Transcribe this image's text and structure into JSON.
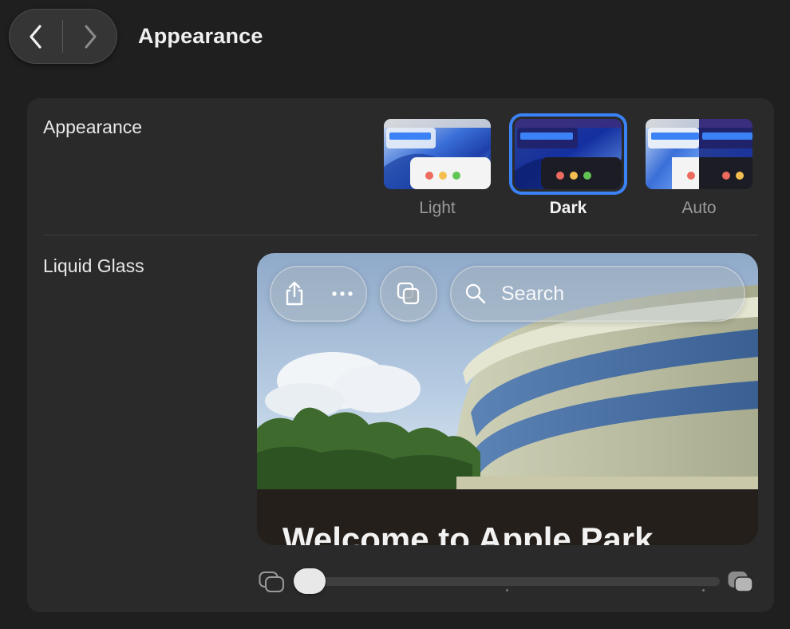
{
  "window": {
    "title": "Appearance",
    "back_icon": "chevron-left-icon",
    "forward_icon": "chevron-right-icon"
  },
  "appearance": {
    "label": "Appearance",
    "options": [
      {
        "label": "Light",
        "selected": false
      },
      {
        "label": "Dark",
        "selected": true
      },
      {
        "label": "Auto",
        "selected": false
      }
    ],
    "accent_color": "#3b82f6"
  },
  "liquid_glass": {
    "label": "Liquid Glass",
    "preview": {
      "search_placeholder": "Search",
      "heading": "Welcome to Apple Park",
      "toolbar_icons": [
        "share-icon",
        "more-icon",
        "tabs-icon",
        "search-icon"
      ]
    },
    "slider": {
      "min_icon": "clear-glass-icon",
      "max_icon": "tinted-glass-icon",
      "value": 0.0
    }
  }
}
